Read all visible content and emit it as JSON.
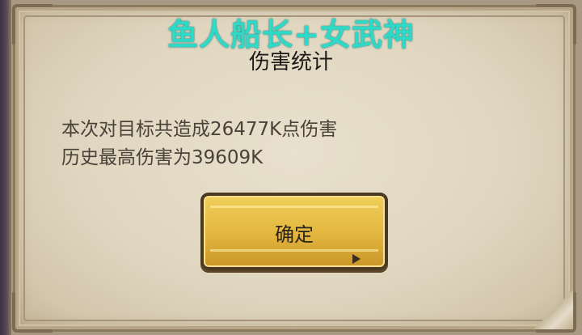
{
  "overlay": {
    "title": "鱼人船长+女武神",
    "color": "#2ed9c8"
  },
  "dialog": {
    "title": "伤害统计",
    "line1": "本次对目标共造成26477K点伤害",
    "line2": "历史最高伤害为39609K",
    "confirm_label": "确定"
  },
  "colors": {
    "parchment": "#e0d6c0",
    "button": "#e2b63e",
    "button_border": "#4a3a22"
  }
}
